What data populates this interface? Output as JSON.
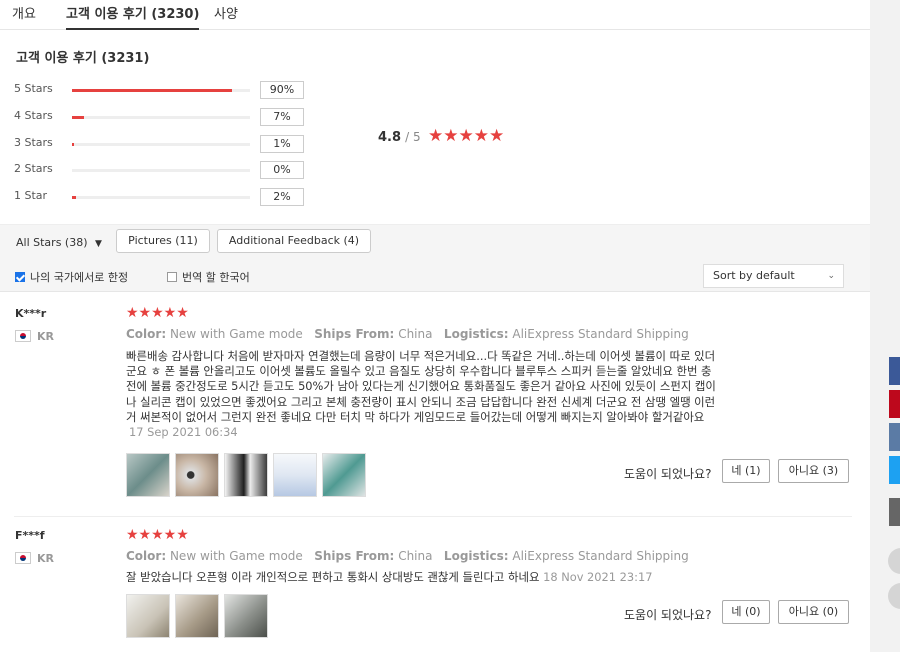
{
  "tabs": [
    {
      "label": "개요"
    },
    {
      "label": "고객 이용 후기 (3230)"
    },
    {
      "label": "사양"
    }
  ],
  "summary": {
    "title": "고객 이용 후기 (3231)",
    "rows": [
      {
        "label": "5 Stars",
        "percent_text": "90%",
        "percent": 90
      },
      {
        "label": "4 Stars",
        "percent_text": "7%",
        "percent": 7
      },
      {
        "label": "3 Stars",
        "percent_text": "1%",
        "percent": 1
      },
      {
        "label": "2 Stars",
        "percent_text": "0%",
        "percent": 0
      },
      {
        "label": "1 Star",
        "percent_text": "2%",
        "percent": 2
      }
    ],
    "average": "4.8",
    "out_of": "/ 5",
    "stars": "★★★★★"
  },
  "filters": {
    "all_stars": "All Stars (38)",
    "pictures": "Pictures (11)",
    "additional": "Additional Feedback (4)",
    "my_country": "나의 국가에서로 한정",
    "translate": "번역 할 한국어",
    "sort": "Sort by default"
  },
  "reviews": [
    {
      "name": "K***r",
      "country": "KR",
      "stars": "★★★★★",
      "color_label": "Color:",
      "color": "New with Game mode",
      "ships_label": "Ships From:",
      "ships": "China",
      "logistics_label": "Logistics:",
      "logistics": "AliExpress Standard Shipping",
      "text_lines": [
        "빠른배송 감사합니다 처음에 받자마자 연결했는데 음량이 너무 적은거네요...다 똑같은 거네..하는데 이어셋 볼륨이 따로 있더",
        "군요 ㅎ 폰 볼륨 안올리고도 이어셋 볼륨도 올릴수 있고 음질도 상당히 우수합니다 블루투스 스피커 듣는줄 알았네요 한번 충",
        "전에 볼륨 중간정도로 5시간 듣고도 50%가 남아 있다는게 신기했어요 통화품질도 좋은거 같아요 사진에 있듯이 스펀지 캡이",
        "나 실리콘 캡이 있었으면 좋겠어요 그리고 본체 충전량이 표시 안되니 조금 답답합니다 완전 신세계 더군요 전 삼땡 엘땡 이런",
        "거 써본적이 없어서 그런지 완전 좋네요 다만 터치 막 하다가 게임모드로 들어갔는데 어떻게 빠지는지 알아봐야 할거같아요"
      ],
      "date": "17 Sep 2021 06:34",
      "helpful": "도움이 되었나요?",
      "yes": "네 (1)",
      "no": "아니요 (3)"
    },
    {
      "name": "F***f",
      "country": "KR",
      "stars": "★★★★★",
      "color_label": "Color:",
      "color": "New with Game mode",
      "ships_label": "Ships From:",
      "ships": "China",
      "logistics_label": "Logistics:",
      "logistics": "AliExpress Standard Shipping",
      "text": "잘 받았습니다 오픈형 이라 개인적으로 편하고 통화시 상대방도 괜찮게 들린다고 하네요",
      "date": "18 Nov 2021 23:17",
      "helpful": "도움이 되었나요?",
      "yes": "네 (0)",
      "no": "아니요 (0)"
    }
  ],
  "colors": {
    "accent_red": "#e6413f",
    "facebook": "#3b5998",
    "pinterest": "#bd081c",
    "vk": "#5b7ba5",
    "twitter": "#1da1f2",
    "other": "#666666"
  }
}
